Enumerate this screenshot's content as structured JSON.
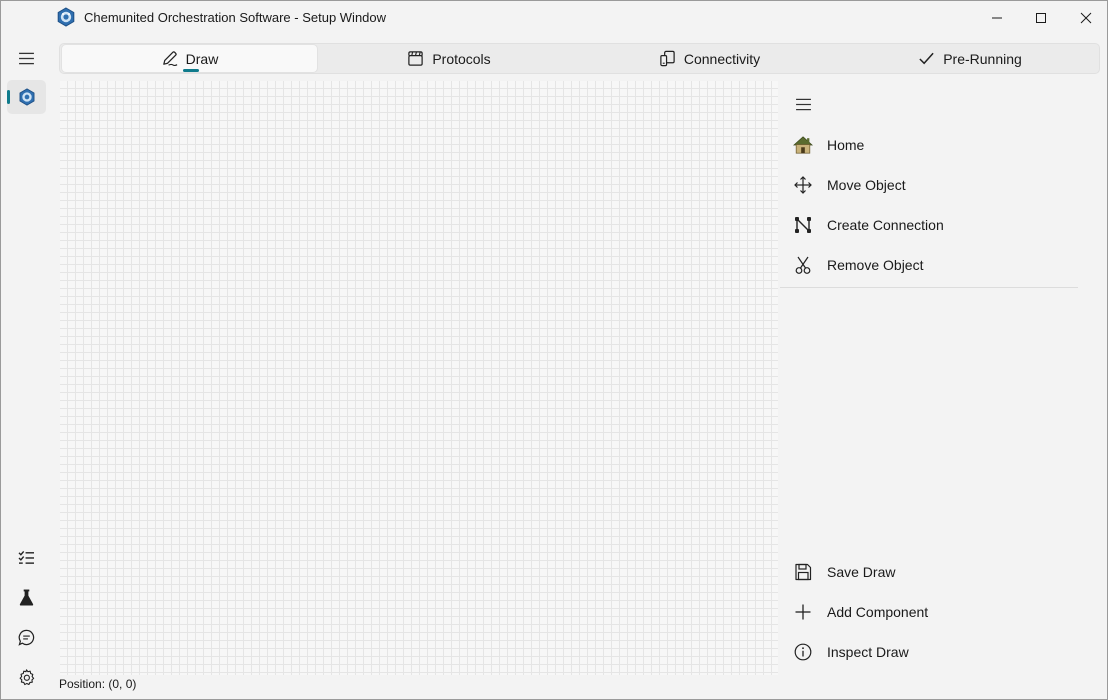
{
  "window": {
    "title": "Chemunited Orchestration Software - Setup Window"
  },
  "tabs": [
    {
      "label": "Draw",
      "icon": "pen-icon",
      "selected": true
    },
    {
      "label": "Protocols",
      "icon": "clapperboard-icon"
    },
    {
      "label": "Connectivity",
      "icon": "connectivity-icon"
    },
    {
      "label": "Pre-Running",
      "icon": "checkmark-icon"
    }
  ],
  "side_menu": {
    "items": [
      {
        "label": "Home",
        "icon": "home-icon"
      },
      {
        "label": "Move Object",
        "icon": "move-icon"
      },
      {
        "label": "Create Connection",
        "icon": "connection-icon"
      },
      {
        "label": "Remove Object",
        "icon": "scissors-icon"
      }
    ],
    "bottom_items": [
      {
        "label": "Save Draw",
        "icon": "save-icon"
      },
      {
        "label": "Add Component",
        "icon": "plus-icon"
      },
      {
        "label": "Inspect Draw",
        "icon": "info-icon"
      }
    ]
  },
  "status": {
    "position": "Position: (0, 0)"
  },
  "colors": {
    "accent": "#0f7b8c",
    "home_roof": "#5a6b2e"
  }
}
